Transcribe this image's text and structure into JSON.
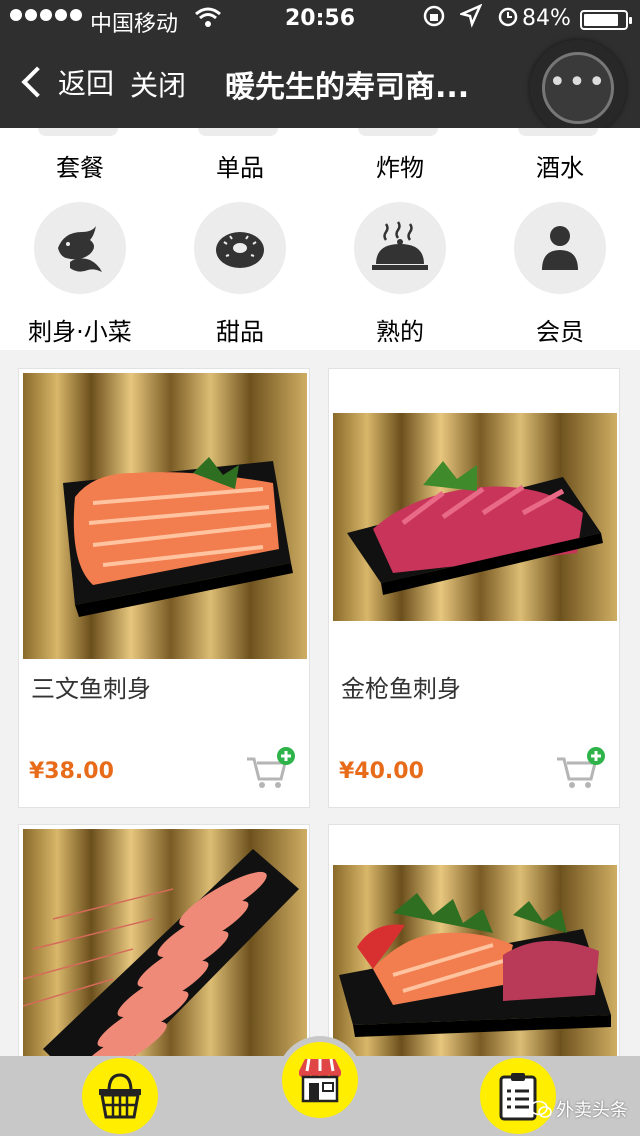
{
  "status_bar": {
    "carrier": "中国移动",
    "time": "20:56",
    "battery": "84%",
    "battery_level": 0.84
  },
  "nav": {
    "back_label": "返回",
    "close_label": "关闭",
    "title": "暖先生的寿司商..."
  },
  "categories": [
    {
      "label": "套餐"
    },
    {
      "label": "单品"
    },
    {
      "label": "炸物"
    },
    {
      "label": "酒水"
    },
    {
      "label": "刺身·小菜",
      "icon": "fish-icon"
    },
    {
      "label": "甜品",
      "icon": "donut-icon"
    },
    {
      "label": "熟的",
      "icon": "cloche-icon"
    },
    {
      "label": "会员",
      "icon": "person-icon"
    }
  ],
  "products": [
    {
      "name": "三文鱼刺身",
      "price": "¥38.00"
    },
    {
      "name": "金枪鱼刺身",
      "price": "¥40.00"
    },
    {
      "name": "",
      "price": ""
    },
    {
      "name": "",
      "price": ""
    }
  ],
  "bottom_bar": {
    "tabs": [
      "basket-icon",
      "store-icon",
      "order-list-icon"
    ]
  },
  "watermark": {
    "text": "外卖头条"
  },
  "colors": {
    "header": "#2f2f2f",
    "price": "#e86b1a",
    "tab_button": "#ffee00",
    "add_badge": "#2db34a"
  }
}
